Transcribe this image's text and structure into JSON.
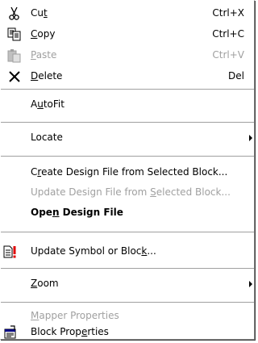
{
  "menu": {
    "cut": {
      "label_before": "Cu",
      "label_accel": "t",
      "label_after": "",
      "shortcut": "Ctrl+X",
      "icon": "scissors-icon"
    },
    "copy": {
      "label_before": "",
      "label_accel": "C",
      "label_after": "opy",
      "shortcut": "Ctrl+C",
      "icon": "copy-icon"
    },
    "paste": {
      "label_before": "",
      "label_accel": "P",
      "label_after": "aste",
      "shortcut": "Ctrl+V",
      "icon": "paste-icon",
      "disabled": true
    },
    "delete": {
      "label_before": "",
      "label_accel": "D",
      "label_after": "elete",
      "shortcut": "Del",
      "icon": "delete-x-icon"
    },
    "autofit": {
      "label_before": "A",
      "label_accel": "u",
      "label_after": "toFit"
    },
    "locate": {
      "label": "Locate",
      "submenu": true
    },
    "create_design_file": {
      "label_before": "C",
      "label_accel": "r",
      "label_after": "eate Design File from Selected Block..."
    },
    "update_design_file": {
      "label_before": "Update Design File from ",
      "label_accel": "S",
      "label_after": "elected Block...",
      "disabled": true
    },
    "open_design_file": {
      "label_before": "Ope",
      "label_accel": "n",
      "label_after": " Design File",
      "bold": true
    },
    "update_symbol": {
      "label_before": "Update Symbol or Bloc",
      "label_accel": "k",
      "label_after": "...",
      "icon": "update-symbol-icon"
    },
    "zoom": {
      "label_before": "",
      "label_accel": "Z",
      "label_after": "oom",
      "submenu": true
    },
    "mapper_properties": {
      "label_before": "",
      "label_accel": "M",
      "label_after": "apper Properties",
      "disabled": true
    },
    "block_properties": {
      "label_before": "Block Prop",
      "label_accel": "e",
      "label_after": "rties",
      "icon": "properties-icon"
    }
  }
}
